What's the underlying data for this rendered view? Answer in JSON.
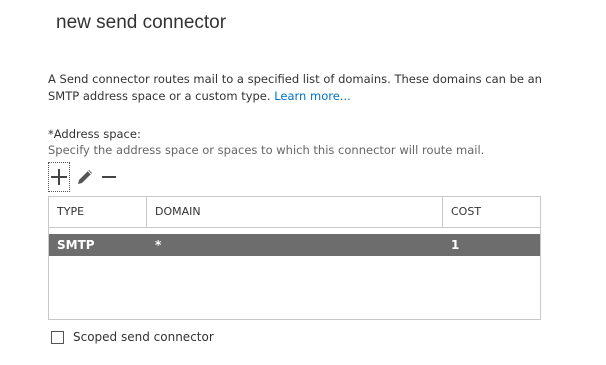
{
  "dialog": {
    "title": "new send connector"
  },
  "description": {
    "text": "A Send connector routes mail to a specified list of domains. These domains can be an SMTP address space or a custom type. ",
    "learn_more": "Learn more..."
  },
  "address_space": {
    "label": "*Address space:",
    "hint": "Specify the address space or spaces to which this connector will route mail."
  },
  "toolbar": {
    "add_icon": "plus-icon",
    "edit_icon": "pencil-icon",
    "remove_icon": "minus-icon"
  },
  "table": {
    "columns": [
      "TYPE",
      "DOMAIN",
      "COST"
    ],
    "rows": [
      {
        "type": "SMTP",
        "domain": "*",
        "cost": "1"
      }
    ],
    "selected_row_color": "#6d6d6d"
  },
  "scoped": {
    "label": "Scoped send connector",
    "checked": false
  },
  "colors": {
    "link": "#0072c6",
    "border": "#c8c8c8"
  }
}
